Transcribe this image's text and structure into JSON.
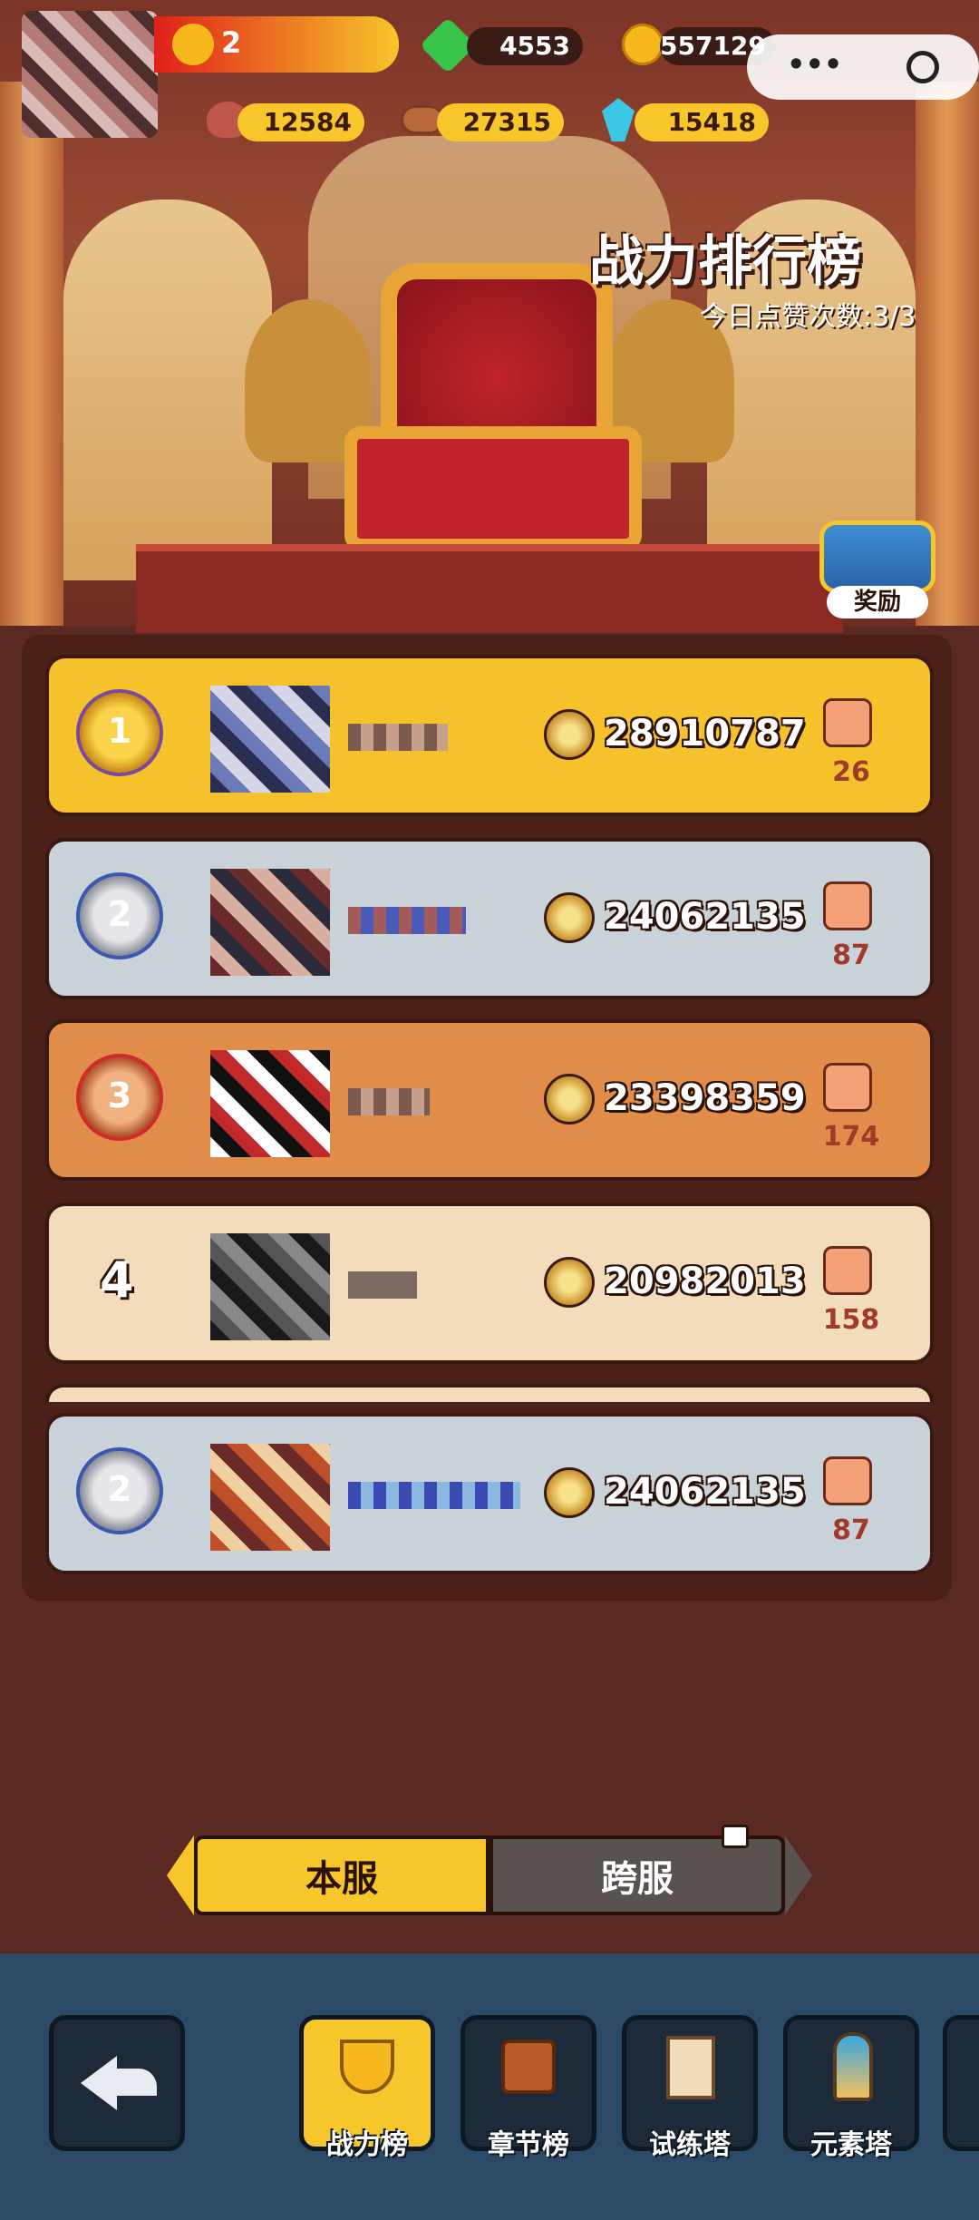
{
  "resources": {
    "account_id": "2",
    "gems": "4553",
    "coins": "557129",
    "meat": "12584",
    "wood": "27315",
    "crystal": "15418"
  },
  "header": {
    "title": "战力排行榜",
    "likes_today": "今日点赞次数:3/3",
    "reward_label": "奖励"
  },
  "ranking": {
    "rows": [
      {
        "rank": "1",
        "power": "28910787",
        "likes": "26"
      },
      {
        "rank": "2",
        "power": "24062135",
        "likes": "87"
      },
      {
        "rank": "3",
        "power": "23398359",
        "likes": "174"
      },
      {
        "rank": "4",
        "power": "20982013",
        "likes": "158"
      }
    ],
    "self": {
      "rank": "2",
      "power": "24062135",
      "likes": "87"
    }
  },
  "tabs": {
    "local": "本服",
    "cross": "跨服"
  },
  "nav": {
    "power_rank": "战力榜",
    "chapter_rank": "章节榜",
    "trial_tower": "试练塔",
    "element_tower": "元素塔"
  },
  "colors": {
    "gold_row": "#f5c22c",
    "silver_row": "#c8d2d8",
    "bronze_row": "#e18c48",
    "plain_row": "#f2dcbc",
    "accent": "#f6c62a"
  }
}
